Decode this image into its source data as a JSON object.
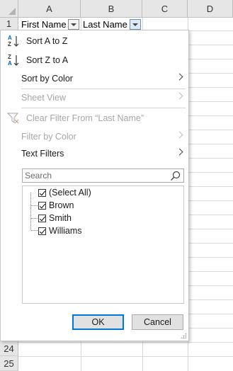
{
  "columns": [
    "A",
    "B",
    "C",
    "D"
  ],
  "rows_top": [
    "1"
  ],
  "rows_bottom": [
    "24",
    "25"
  ],
  "cells": {
    "A1": "First Name",
    "B1": "Last Name"
  },
  "menu": {
    "sort_az": "Sort A to Z",
    "sort_za": "Sort Z to A",
    "sort_by_color": "Sort by Color",
    "sheet_view": "Sheet View",
    "clear_filter": "Clear Filter From “Last Name”",
    "filter_by_color": "Filter by Color",
    "text_filters": "Text Filters",
    "search_placeholder": "Search",
    "items": [
      "(Select All)",
      "Brown",
      "Smith",
      "Williams"
    ],
    "ok": "OK",
    "cancel": "Cancel"
  },
  "colors": {
    "accent": "#0078d7",
    "header_bg": "#e6e6e6",
    "disabled": "#a6a6a6",
    "sort_a": "#0063b1"
  }
}
